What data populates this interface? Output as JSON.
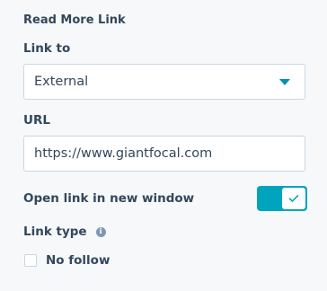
{
  "section": {
    "title": "Read More Link"
  },
  "link_to": {
    "label": "Link to",
    "selected": "External"
  },
  "url": {
    "label": "URL",
    "value": "https://www.giantfocal.com"
  },
  "new_window": {
    "label": "Open link in new window",
    "enabled": true
  },
  "link_type": {
    "label": "Link type",
    "info_icon": "info-icon",
    "no_follow_label": "No follow",
    "no_follow_checked": false
  },
  "colors": {
    "accent": "#00a4bd",
    "caret": "#0091ae",
    "text": "#33475b",
    "border": "#cbd6e2",
    "background": "#f6f8fa"
  }
}
